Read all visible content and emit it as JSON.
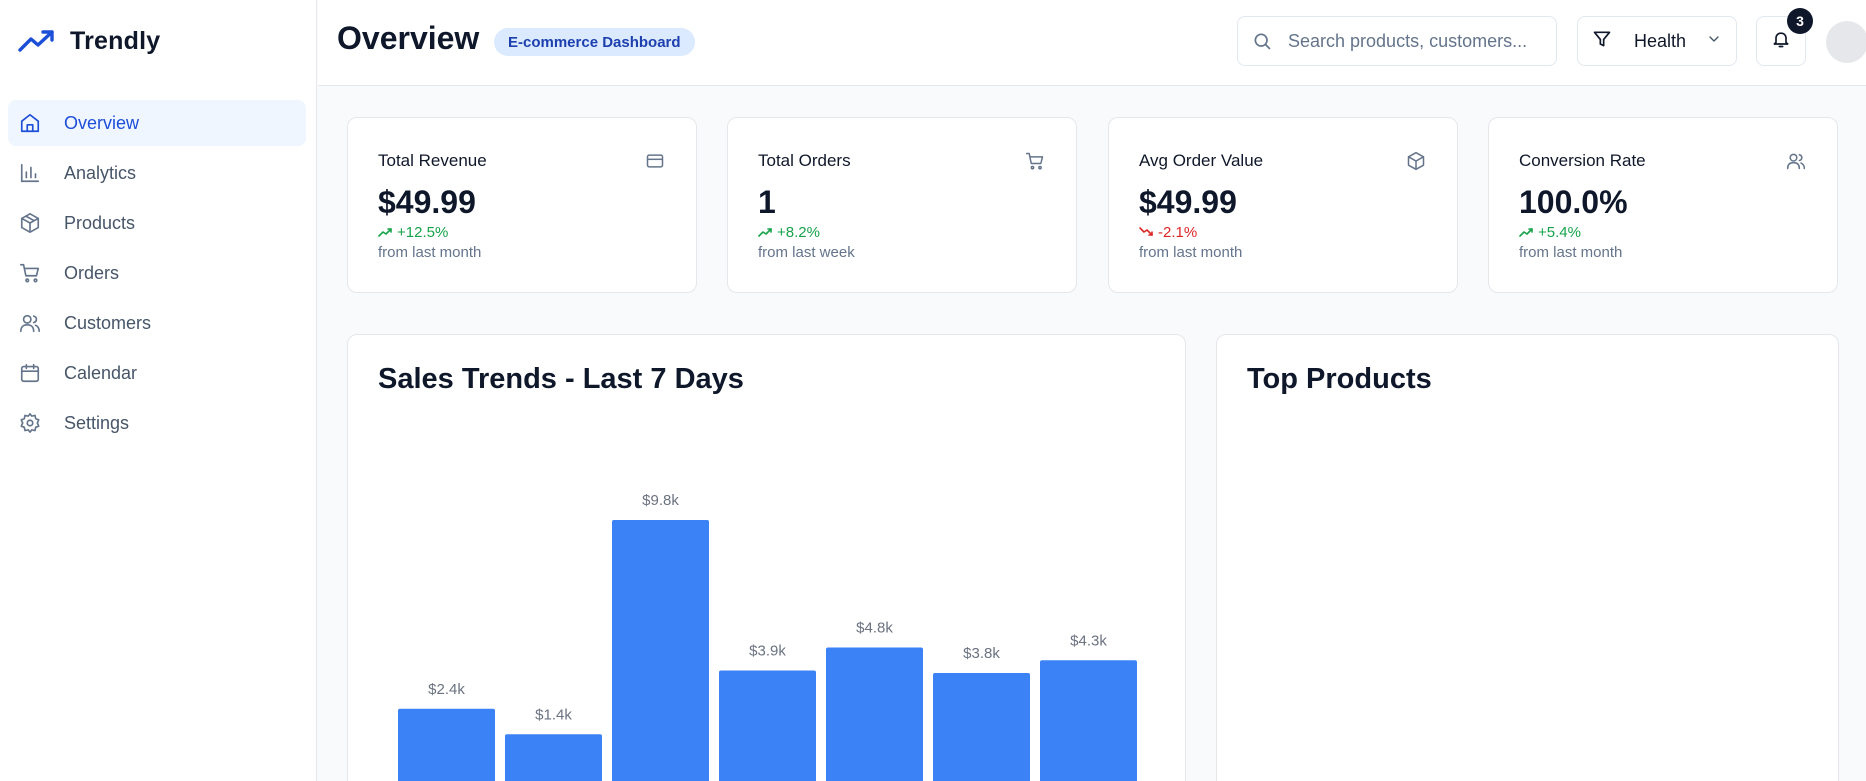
{
  "app": {
    "name": "Trendly"
  },
  "sidebar": {
    "items": [
      {
        "label": "Overview",
        "icon": "home-icon",
        "active": true
      },
      {
        "label": "Analytics",
        "icon": "bar-chart-icon",
        "active": false
      },
      {
        "label": "Products",
        "icon": "package-icon",
        "active": false
      },
      {
        "label": "Orders",
        "icon": "cart-icon",
        "active": false
      },
      {
        "label": "Customers",
        "icon": "users-icon",
        "active": false
      },
      {
        "label": "Calendar",
        "icon": "calendar-icon",
        "active": false
      },
      {
        "label": "Settings",
        "icon": "gear-icon",
        "active": false
      }
    ]
  },
  "header": {
    "title": "Overview",
    "badge": "E-commerce Dashboard",
    "search_placeholder": "Search products, customers...",
    "filter_label": "Health",
    "notification_count": "3"
  },
  "stats": [
    {
      "title": "Total Revenue",
      "value": "$49.99",
      "change": "+12.5%",
      "trend": "up",
      "period": "from last month",
      "icon": "credit-card-icon"
    },
    {
      "title": "Total Orders",
      "value": "1",
      "change": "+8.2%",
      "trend": "up",
      "period": "from last week",
      "icon": "cart-icon"
    },
    {
      "title": "Avg Order Value",
      "value": "$49.99",
      "change": "-2.1%",
      "trend": "down",
      "period": "from last month",
      "icon": "package-icon"
    },
    {
      "title": "Conversion Rate",
      "value": "100.0%",
      "change": "+5.4%",
      "trend": "up",
      "period": "from last month",
      "icon": "users-icon"
    }
  ],
  "sales_panel": {
    "title": "Sales Trends - Last 7 Days"
  },
  "top_products_panel": {
    "title": "Top Products"
  },
  "chart_data": {
    "type": "bar",
    "title": "Sales Trends - Last 7 Days",
    "values": [
      2400,
      1400,
      9800,
      3900,
      4800,
      3800,
      4300
    ],
    "labels": [
      "$2.4k",
      "$1.4k",
      "$9.8k",
      "$3.9k",
      "$4.8k",
      "$3.8k",
      "$4.3k"
    ],
    "color": "#3b82f6"
  },
  "colors": {
    "accent": "#1d4ed8",
    "bar": "#3b82f6",
    "positive": "#16a34a",
    "negative": "#dc2626"
  }
}
